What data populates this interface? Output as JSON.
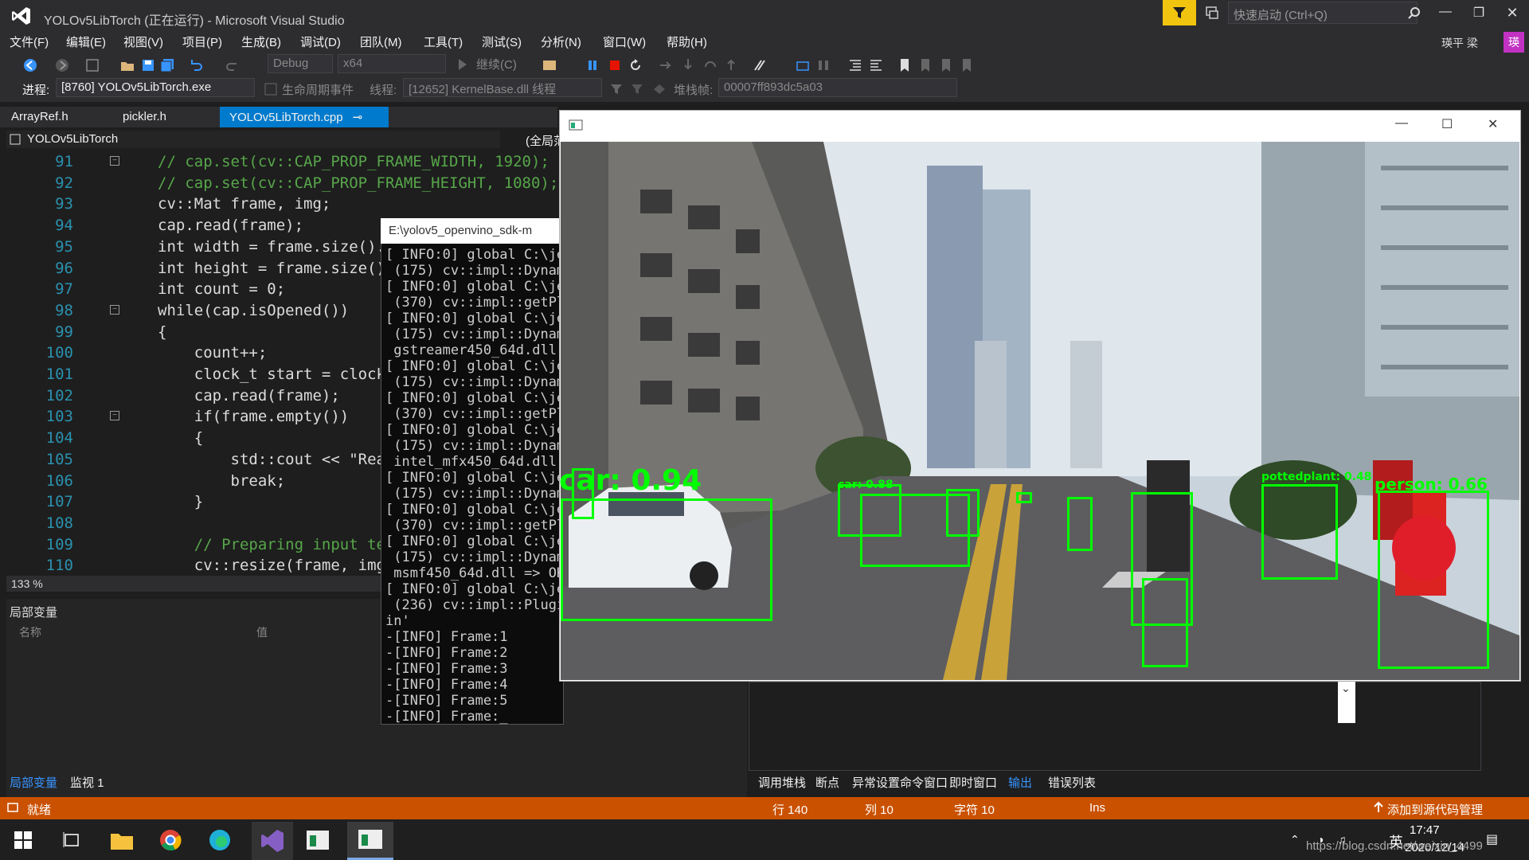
{
  "title": "YOLOv5LibTorch (正在运行) - Microsoft Visual Studio",
  "quick_launch": "快速启动 (Ctrl+Q)",
  "user_name": "瑛平 梁",
  "user_initial": "瑛",
  "menu": [
    "文件(F)",
    "编辑(E)",
    "视图(V)",
    "项目(P)",
    "生成(B)",
    "调试(D)",
    "团队(M)",
    "工具(T)",
    "测试(S)",
    "分析(N)",
    "窗口(W)",
    "帮助(H)"
  ],
  "toolbar": {
    "config": "Debug",
    "platform": "x64",
    "continue": "继续(C)"
  },
  "debugbar": {
    "process_label": "进程:",
    "process": "[8760] YOLOv5LibTorch.exe",
    "lifecycle": "生命周期事件",
    "thread_label": "线程:",
    "thread": "[12652] KernelBase.dll 线程",
    "stack_label": "堆栈帧:",
    "stack": "00007ff893dc5a03"
  },
  "tabs": [
    "ArrayRef.h",
    "pickler.h",
    "YOLOv5LibTorch.cpp"
  ],
  "nav_project": "YOLOv5LibTorch",
  "nav_scope": "(全局范",
  "code_lines": [
    {
      "n": "91",
      "t": "// cap.set(cv::CAP_PROP_FRAME_WIDTH, 1920);"
    },
    {
      "n": "92",
      "t": "// cap.set(cv::CAP_PROP_FRAME_HEIGHT, 1080);"
    },
    {
      "n": "93",
      "t": "cv::Mat frame, img;"
    },
    {
      "n": "94",
      "t": "cap.read(frame);"
    },
    {
      "n": "95",
      "t": "int width = frame.size().w"
    },
    {
      "n": "96",
      "t": "int height = frame.size()."
    },
    {
      "n": "97",
      "t": "int count = 0;"
    },
    {
      "n": "98",
      "t": "while(cap.isOpened())"
    },
    {
      "n": "99",
      "t": "{"
    },
    {
      "n": "100",
      "t": "    count++;"
    },
    {
      "n": "101",
      "t": "    clock_t start = clock("
    },
    {
      "n": "102",
      "t": "    cap.read(frame);"
    },
    {
      "n": "103",
      "t": "    if(frame.empty())"
    },
    {
      "n": "104",
      "t": "    {"
    },
    {
      "n": "105",
      "t": "        std::cout << \"Read"
    },
    {
      "n": "106",
      "t": "        break;"
    },
    {
      "n": "107",
      "t": "    }"
    },
    {
      "n": "108",
      "t": ""
    },
    {
      "n": "109",
      "t": "    // Preparing input ten"
    },
    {
      "n": "110",
      "t": "    cv::resize(frame, img,"
    }
  ],
  "zoom": "133 %",
  "locals": {
    "title": "局部变量",
    "col_name": "名称",
    "col_value": "值"
  },
  "bottom_left_tabs": [
    "局部变量",
    "监视 1"
  ],
  "console": {
    "title": "E:\\yolov5_openvino_sdk-m",
    "lines": [
      "[ INFO:0] global C:\\je",
      " (175) cv::impl::Dynam",
      "[ INFO:0] global C:\\je",
      " (370) cv::impl::getPl",
      "[ INFO:0] global C:\\je",
      " (175) cv::impl::Dynam",
      " gstreamer450_64d.dll =",
      "[ INFO:0] global C:\\je",
      " (175) cv::impl::Dynam",
      "[ INFO:0] global C:\\je",
      " (370) cv::impl::getPl",
      "[ INFO:0] global C:\\je",
      " (175) cv::impl::Dynam",
      " intel_mfx450_64d.dll =",
      "[ INFO:0] global C:\\je",
      " (175) cv::impl::Dynam",
      "[ INFO:0] global C:\\je",
      " (370) cv::impl::getPl",
      "[ INFO:0] global C:\\je",
      " (175) cv::impl::Dynam",
      " msmf450_64d.dll => OK",
      "[ INFO:0] global C:\\je",
      " (236) cv::impl::Plugi",
      "in'",
      "-[INFO] Frame:1",
      "-[INFO] Frame:2",
      "-[INFO] Frame:3",
      "-[INFO] Frame:4",
      "-[INFO] Frame:5",
      "-[INFO] Frame:_"
    ]
  },
  "detections": [
    {
      "label": "car: 0.94"
    },
    {
      "label": "car: 0.88"
    },
    {
      "label": "person: 0.66"
    },
    {
      "label": "pottedplant: 0.48"
    },
    {
      "label": ""
    },
    {
      "label": ""
    },
    {
      "label": ""
    },
    {
      "label": ""
    },
    {
      "label": ""
    },
    {
      "label": ""
    },
    {
      "label": ""
    }
  ],
  "bottom_right_tabs": [
    "调用堆栈",
    "断点",
    "异常设置",
    "命令窗口",
    "即时窗口",
    "输出",
    "错误列表"
  ],
  "status": {
    "ready": "就绪",
    "row": "行 140",
    "col": "列 10",
    "char": "字符 10",
    "ins": "Ins",
    "source": "添加到源代码管理"
  },
  "clock": {
    "time": "17:47",
    "date": "2020/12/14",
    "url": "https://blog.csdn.net/weixin_4499"
  },
  "colors": {
    "accent": "#007acc",
    "status": "#ca5100",
    "detect": "#00ff00"
  }
}
